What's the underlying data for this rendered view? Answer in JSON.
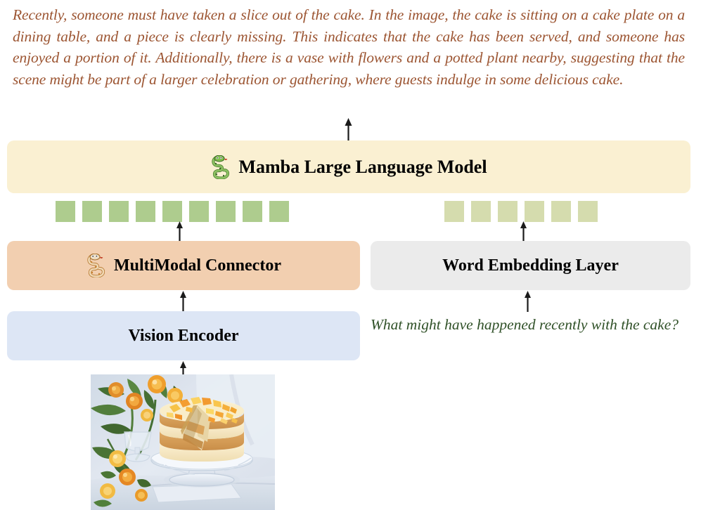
{
  "response": {
    "text": "Recently, someone must have taken a slice out of the cake. In the image, the cake is sitting on a cake plate on a dining table, and a piece is clearly missing. This indicates that the cake has been served, and someone has enjoyed a portion of it. Additionally, there is a vase with flowers and a potted plant nearby, suggesting that the scene might be part of a larger celebration or gathering, where guests indulge in some delicious cake.",
    "color": "#9C5532"
  },
  "question": {
    "text": "What might have happened recently with the cake?",
    "color": "#2F5027"
  },
  "nodes": {
    "mamba": {
      "label": "Mamba Large Language Model",
      "icon": "green-snake-icon",
      "color": "#FAF0D2"
    },
    "connector": {
      "label": "MultiModal Connector",
      "icon": "orange-snake-icon",
      "color": "#F2CFB0"
    },
    "word_embedding": {
      "label": "Word Embedding Layer",
      "color": "#EBEBEB"
    },
    "vision_encoder": {
      "label": "Vision Encoder",
      "color": "#DDE6F5"
    }
  },
  "tokens": {
    "vision": {
      "count": 9,
      "color": "#AECC8E"
    },
    "text": {
      "count": 6,
      "color": "#D5DCAE"
    }
  },
  "arrows": [
    {
      "name": "arrow-mamba-to-response",
      "direction": "up"
    },
    {
      "name": "arrow-vision-tokens-to-mamba",
      "direction": "up"
    },
    {
      "name": "arrow-text-tokens-to-mamba",
      "direction": "up"
    },
    {
      "name": "arrow-connector-to-vision-tokens",
      "direction": "up"
    },
    {
      "name": "arrow-word-embedding-to-text-tokens",
      "direction": "up"
    },
    {
      "name": "arrow-vision-encoder-to-connector",
      "direction": "up"
    },
    {
      "name": "arrow-question-to-word-embedding",
      "direction": "up"
    },
    {
      "name": "arrow-image-to-vision-encoder",
      "direction": "up"
    }
  ],
  "image": {
    "alt": "cake-with-missing-slice-photo"
  }
}
